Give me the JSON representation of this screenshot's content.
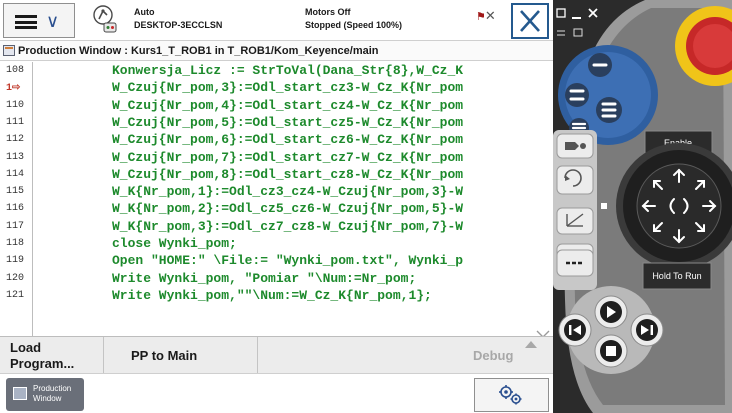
{
  "header": {
    "operating_mode": "Auto",
    "controller_name": "DESKTOP-3ECCLSN",
    "motors_state": "Motors Off",
    "run_state": "Stopped (Speed 100%)"
  },
  "window": {
    "title": "Production Window : Kurs1_T_ROB1 in T_ROB1/Kom_Keyence/main"
  },
  "code": {
    "lines": [
      {
        "no": "108",
        "text": "Konwersja_Licz := StrToVal(Dana_Str{8},W_Cz_K"
      },
      {
        "no": "1⇨",
        "text": "W_Czuj{Nr_pom,3}:=Odl_start_cz3-W_Cz_K{Nr_pom"
      },
      {
        "no": "110",
        "text": "W_Czuj{Nr_pom,4}:=Odl_start_cz4-W_Cz_K{Nr_pom"
      },
      {
        "no": "111",
        "text": "W_Czuj{Nr_pom,5}:=Odl_start_cz5-W_Cz_K{Nr_pom"
      },
      {
        "no": "112",
        "text": "W_Czuj{Nr_pom,6}:=Odl_start_cz6-W_Cz_K{Nr_pom"
      },
      {
        "no": "113",
        "text": "W_Czuj{Nr_pom,7}:=Odl_start_cz7-W_Cz_K{Nr_pom"
      },
      {
        "no": "114",
        "text": "W_Czuj{Nr_pom,8}:=Odl_start_cz8-W_Cz_K{Nr_pom"
      },
      {
        "no": "115",
        "text": "W_K{Nr_pom,1}:=Odl_cz3_cz4-W_Czuj{Nr_pom,3}-W"
      },
      {
        "no": "116",
        "text": "W_K{Nr_pom,2}:=Odl_cz5_cz6-W_Czuj{Nr_pom,5}-W"
      },
      {
        "no": "117",
        "text": "W_K{Nr_pom,3}:=Odl_cz7_cz8-W_Czuj{Nr_pom,7}-W"
      },
      {
        "no": "118",
        "text": "close Wynki_pom;"
      },
      {
        "no": "119",
        "text": "Open \"HOME:\" \\File:= \"Wynki_pom.txt\", Wynki_p"
      },
      {
        "no": "120",
        "text": "Write Wynki_pom, \"Pomiar \"\\Num:=Nr_pom;"
      },
      {
        "no": "121",
        "text": "Write Wynki_pom,\"\"\\Num:=W_Cz_K{Nr_pom,1};"
      }
    ]
  },
  "command_bar": {
    "load_program_line1": "Load",
    "load_program_line2": "Program...",
    "pp_to_main": "PP to Main",
    "debug": "Debug"
  },
  "taskbar": {
    "production_window_line1": "Production",
    "production_window_line2": "Window"
  },
  "pendant": {
    "enable_label": "Enable",
    "hold_to_run_label": "Hold To Run"
  },
  "colors": {
    "code_text": "#1d8a2c",
    "accent_blue": "#24598e",
    "pendant_body": "#2b2b2b",
    "emergency_stop": "#f0c419"
  },
  "icons": {
    "menu": "hamburger-menu-icon",
    "robot": "robot-status-icon",
    "close": "close-icon",
    "quickset": "gears-icon"
  }
}
